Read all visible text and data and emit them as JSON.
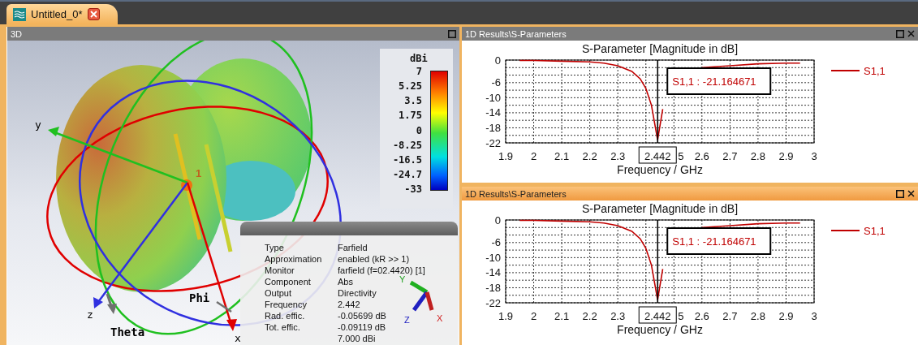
{
  "tab": {
    "label": "Untitled_0*",
    "selected": true
  },
  "view3d": {
    "title": "3D",
    "colorbar": {
      "unit": "dBi",
      "ticks": [
        "7",
        "5.25",
        "3.5",
        "1.75",
        "0",
        "-8.25",
        "-16.5",
        "-24.7",
        "-33"
      ]
    },
    "axes": {
      "x": "x",
      "y": "y",
      "z": "z",
      "phi": "Phi",
      "theta": "Theta",
      "port": "1"
    },
    "triad": {
      "x": "X",
      "y": "Y",
      "z": "Z"
    },
    "info": [
      {
        "label": "Type",
        "value": "Farfield"
      },
      {
        "label": "Approximation",
        "value": "enabled (kR >> 1)"
      },
      {
        "label": "Monitor",
        "value": "farfield (f=02.4420) [1]"
      },
      {
        "label": "Component",
        "value": "Abs"
      },
      {
        "label": "Output",
        "value": "Directivity"
      },
      {
        "label": "Frequency",
        "value": "2.442"
      },
      {
        "label": "Rad. effic.",
        "value": "-0.05699 dB"
      },
      {
        "label": "Tot. effic.",
        "value": "-0.09119 dB"
      },
      {
        "value": "7.000 dBi"
      }
    ]
  },
  "results": [
    {
      "title": "1D Results\\S-Parameters",
      "selected": false,
      "partial_tick_label": "5",
      "chart_data": {
        "type": "line",
        "title": "S-Parameter [Magnitude in dB]",
        "xlabel": "Frequency / GHz",
        "grid": true,
        "x": [
          1.95,
          2.0,
          2.1,
          2.2,
          2.25,
          2.3,
          2.35,
          2.38,
          2.4,
          2.42,
          2.442,
          2.46,
          2.48,
          2.5,
          2.55,
          2.6,
          2.7,
          2.8,
          2.9,
          2.95
        ],
        "series": [
          {
            "name": "S1,1",
            "color": "#c00000",
            "values": [
              -0.1,
              -0.1,
              -0.3,
              -0.5,
              -0.8,
              -1.5,
              -3,
              -5,
              -7.5,
              -12,
              -21.2,
              -13,
              null,
              null,
              null,
              -2,
              -1.5,
              -1,
              -0.8,
              -0.8
            ]
          }
        ],
        "xlim": [
          1.9,
          3
        ],
        "ylim": [
          -22,
          0
        ],
        "xticks": [
          1.9,
          2,
          2.1,
          2.2,
          2.3,
          2.6,
          2.7,
          2.8,
          2.9,
          3
        ],
        "yticks": [
          0,
          -6,
          -10,
          -14,
          -18,
          -22
        ],
        "ref_lines": [
          {
            "axis": "x",
            "value": 2.442,
            "label": "2.442"
          }
        ],
        "annotations": [
          "S1,1 : -21.164671"
        ]
      }
    },
    {
      "title": "1D Results\\S-Parameters",
      "selected": true,
      "partial_tick_label": "5",
      "chart_data": {
        "type": "line",
        "title": "S-Parameter [Magnitude in dB]",
        "xlabel": "Frequency / GHz",
        "grid": true,
        "x": [
          1.95,
          2.0,
          2.1,
          2.2,
          2.25,
          2.3,
          2.35,
          2.38,
          2.4,
          2.42,
          2.442,
          2.46,
          2.48,
          2.5,
          2.55,
          2.6,
          2.7,
          2.8,
          2.9,
          2.95
        ],
        "series": [
          {
            "name": "S1,1",
            "color": "#c00000",
            "values": [
              -0.1,
              -0.1,
              -0.3,
              -0.5,
              -0.8,
              -1.5,
              -3,
              -5,
              -7.5,
              -12,
              -21.2,
              -13,
              null,
              null,
              null,
              -2,
              -1.5,
              -1,
              -0.8,
              -0.8
            ]
          }
        ],
        "xlim": [
          1.9,
          3
        ],
        "ylim": [
          -22,
          0
        ],
        "xticks": [
          1.9,
          2,
          2.1,
          2.2,
          2.3,
          2.6,
          2.7,
          2.8,
          2.9,
          3
        ],
        "yticks": [
          0,
          -6,
          -10,
          -14,
          -18,
          -22
        ],
        "ref_lines": [
          {
            "axis": "x",
            "value": 2.442,
            "label": "2.442"
          }
        ],
        "annotations": [
          "S1,1 : -21.164671"
        ]
      }
    }
  ]
}
